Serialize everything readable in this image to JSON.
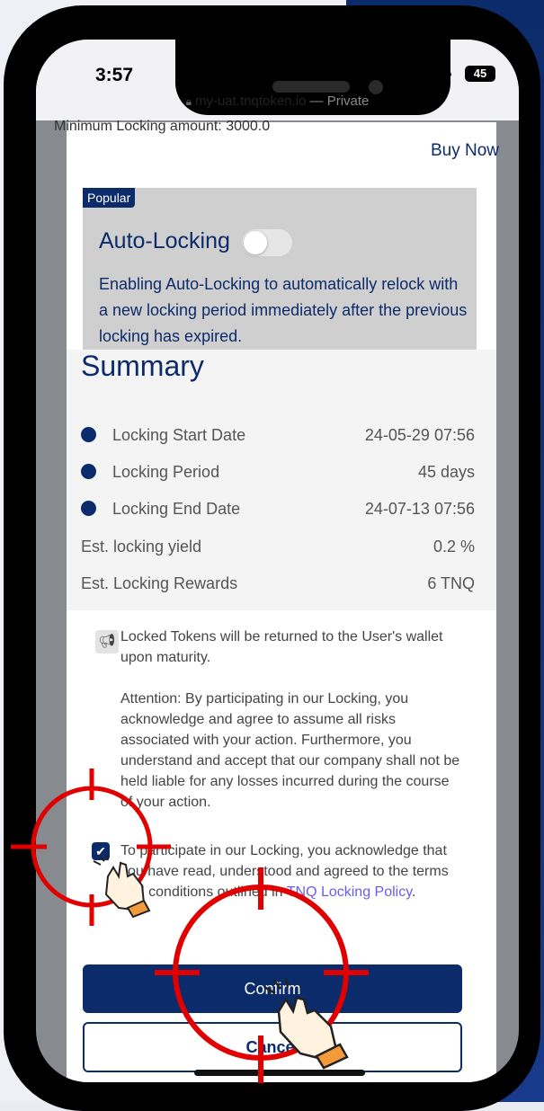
{
  "status": {
    "time": "3:57",
    "battery": "45"
  },
  "browser": {
    "url": "my-uat.tnqtoken.io",
    "mode": "— Private"
  },
  "product": {
    "min_locking": "Minimum Locking amount: 3000.0",
    "buy_now": "Buy Now"
  },
  "auto_locking": {
    "badge": "Popular",
    "title": "Auto-Locking",
    "enabled": false,
    "description": "Enabling Auto-Locking to automatically relock with a new locking period immediately after the previous locking has expired."
  },
  "summary": {
    "title": "Summary",
    "rows": [
      {
        "label": "Locking Start Date",
        "value": "24-05-29 07:56"
      },
      {
        "label": "Locking Period",
        "value": "45 days"
      },
      {
        "label": "Locking End Date",
        "value": "24-07-13 07:56"
      },
      {
        "label": "Est. locking yield",
        "value": "0.2 %"
      },
      {
        "label": "Est. Locking Rewards",
        "value": "6 TNQ"
      }
    ]
  },
  "notice": {
    "returned": "Locked Tokens will be returned to the User's wallet upon maturity.",
    "attention": "Attention: By participating in our Locking, you acknowledge and agree to assume all risks associated with your action. Furthermore, you understand and accept that our company shall not be held liable for any losses incurred during the course of your action.",
    "ack_text": "To participate in our Locking, you acknowledge that you have read, understood and agreed to the terms and conditions outlined in",
    "ack_link": "TNQ Locking Policy",
    "ack_end": ".",
    "checked": true
  },
  "actions": {
    "confirm": "Confirm",
    "cancel": "Cancel"
  },
  "colors": {
    "brand": "#0c2b6b",
    "annotation": "#e00000",
    "link": "#6b5ce7"
  },
  "icons": [
    "lock-icon",
    "wifi-icon",
    "signal-icon",
    "battery-icon",
    "megaphone-icon",
    "checkmark-icon",
    "crosshair-icon",
    "tap-hand-icon"
  ]
}
